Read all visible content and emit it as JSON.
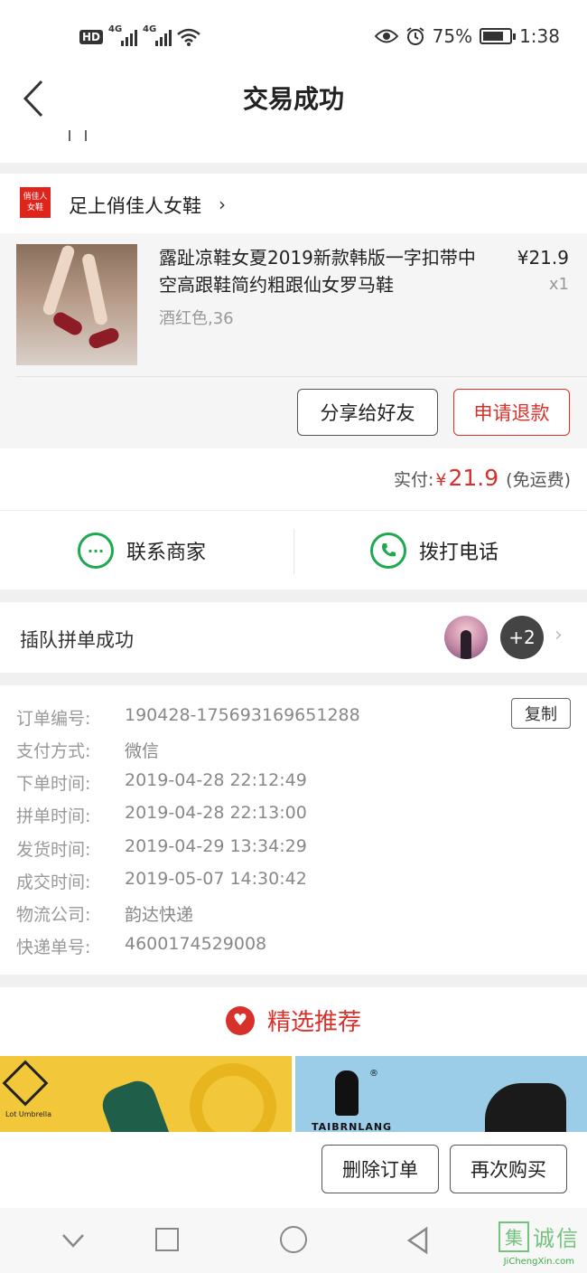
{
  "status_bar": {
    "battery": "75%",
    "time": "1:38",
    "hd_label": "HD",
    "network_1": "4G",
    "network_2": "4G"
  },
  "header": {
    "title": "交易成功"
  },
  "store": {
    "logo_text": "俏佳人 女鞋",
    "name": "足上俏佳人女鞋"
  },
  "product": {
    "title": "露趾凉鞋女夏2019新款韩版一字扣带中空高跟鞋简约粗跟仙女罗马鞋",
    "price": "¥21.9",
    "quantity": "x1",
    "variant": "酒红色,36",
    "share_button": "分享给好友",
    "refund_button": "申请退款"
  },
  "payment": {
    "label": "实付:",
    "currency": "¥",
    "amount": "21.9",
    "note": "(免运费)"
  },
  "contact": {
    "merchant": "联系商家",
    "call": "拨打电话"
  },
  "group": {
    "title": "插队拼单成功",
    "extra_count": "+2"
  },
  "order_info": {
    "copy_button": "复制",
    "rows": [
      {
        "label": "订单编号:",
        "value": "190428-175693169651288"
      },
      {
        "label": "支付方式:",
        "value": "微信"
      },
      {
        "label": "下单时间:",
        "value": "2019-04-28 22:12:49"
      },
      {
        "label": "拼单时间:",
        "value": "2019-04-28 22:13:00"
      },
      {
        "label": "发货时间:",
        "value": "2019-04-29 13:34:29"
      },
      {
        "label": "成交时间:",
        "value": "2019-05-07 14:30:42"
      },
      {
        "label": "物流公司:",
        "value": "韵达快递"
      },
      {
        "label": "快递单号:",
        "value": "4600174529008"
      }
    ]
  },
  "recommend": {
    "title": "精选推荐",
    "card1_brand": "Lot Umbrella",
    "card2_brand": "TAIBRNLANG",
    "card2_reg": "®"
  },
  "bottom_actions": {
    "delete": "删除订单",
    "rebuy": "再次购买"
  },
  "watermark": {
    "box": "集",
    "text": "诚信",
    "sub": "JiChengXin.com"
  },
  "colors": {
    "accent_red": "#d8302a",
    "green": "#1fa850"
  }
}
